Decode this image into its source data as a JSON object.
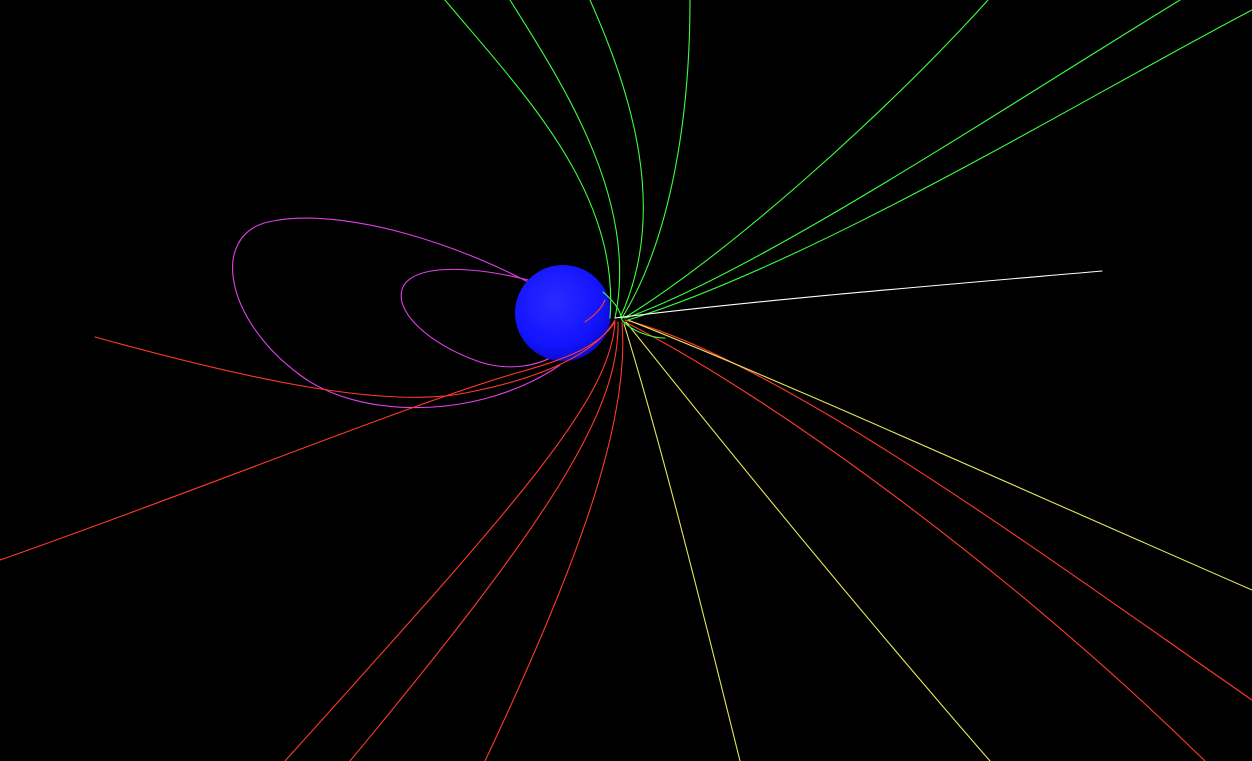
{
  "scene": {
    "background_color": "#000000",
    "planet": {
      "kind": "sphere",
      "color": "#1414ff",
      "highlight_color": "#2a2aff",
      "shadow_color": "#0a0ad0"
    },
    "field_line_groups": [
      {
        "name": "green",
        "color": "#3cff3c",
        "count": 8
      },
      {
        "name": "red",
        "color": "#ff3a2a",
        "count": 8
      },
      {
        "name": "yellow",
        "color": "#e6e65a",
        "count": 3
      },
      {
        "name": "magenta",
        "color": "#e040e8",
        "count": 2
      },
      {
        "name": "white",
        "color": "#ffffff",
        "count": 1
      }
    ]
  }
}
